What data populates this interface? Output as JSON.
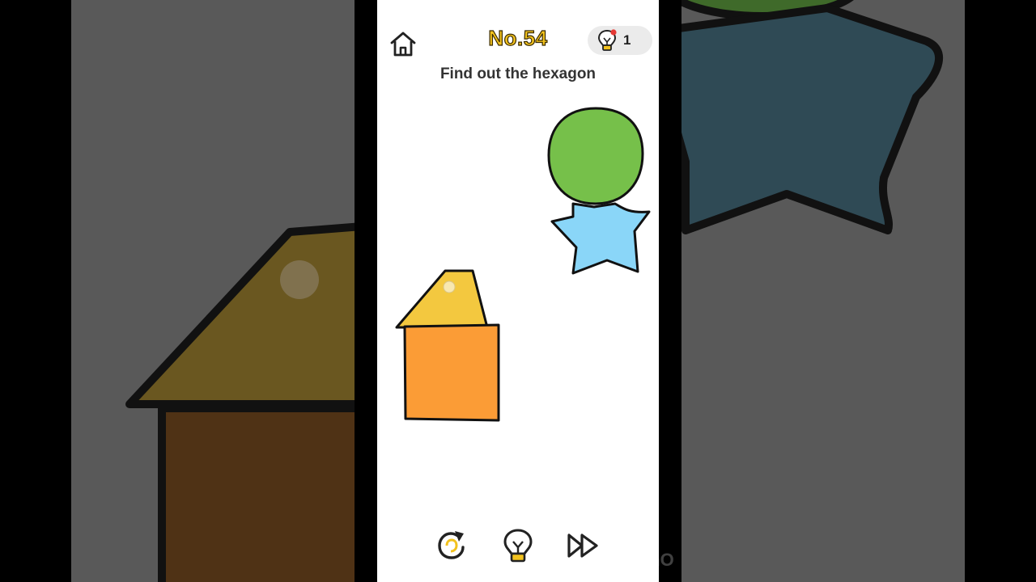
{
  "level": {
    "title": "No.54"
  },
  "instruction": "Find out the hexagon",
  "hints": {
    "count": "1"
  },
  "icons": {
    "home": "home-icon",
    "hint": "lightbulb-icon",
    "restart": "restart-icon",
    "skip": "fast-forward-icon"
  },
  "colors": {
    "level_title": "#f2c21e",
    "circle": "#76c04a",
    "star": "#8ad6f8",
    "roof": "#f3c83f",
    "square": "#fb9c36",
    "background_panels": "#595959"
  },
  "watermark": "InShO"
}
